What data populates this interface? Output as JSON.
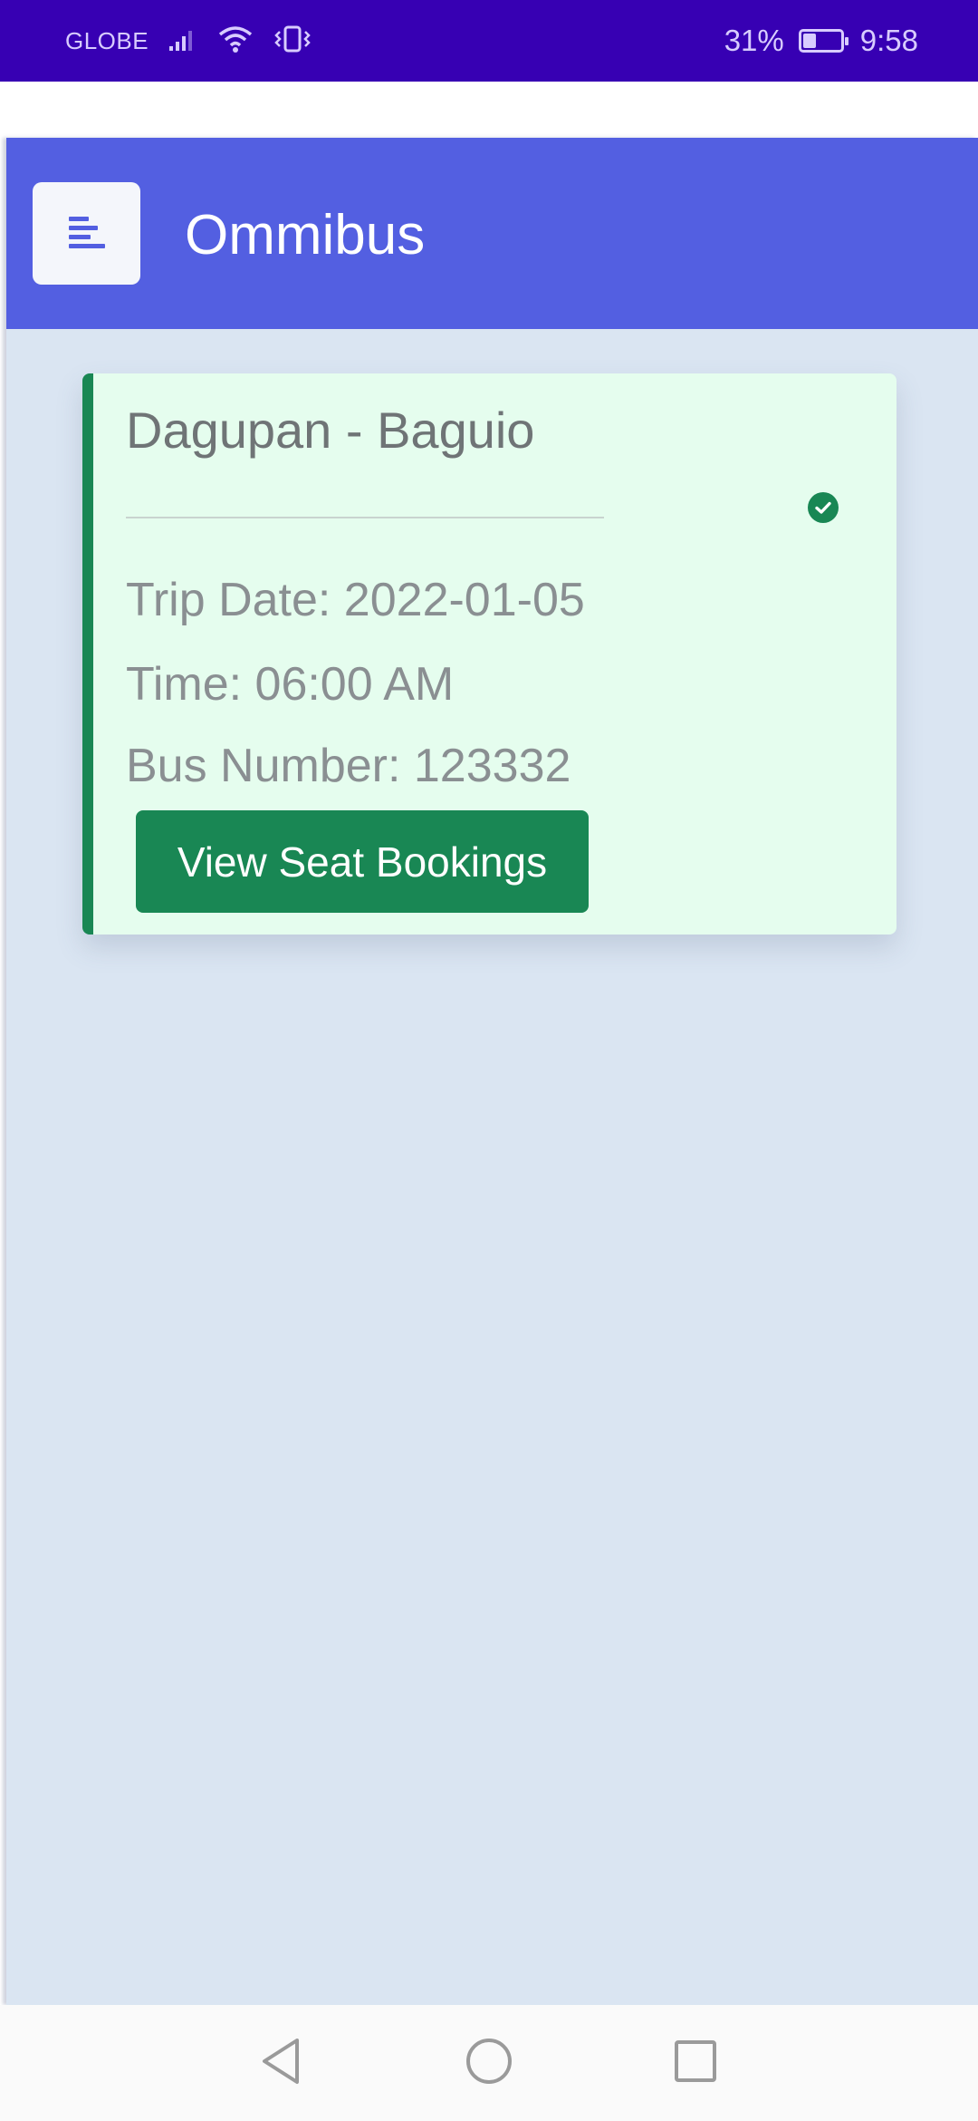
{
  "status_bar": {
    "carrier": "GLOBE",
    "battery": "31%",
    "time": "9:58",
    "icons": [
      "signal-icon",
      "wifi-icon",
      "vibrate-icon",
      "battery-icon"
    ]
  },
  "header": {
    "title": "Ommibus",
    "menu_icon": "menu-icon",
    "color": "#535fe1"
  },
  "trip": {
    "route": "Dagupan - Baguio",
    "trip_date": "Trip Date: 2022-01-05",
    "time": "Time: 06:00 AM",
    "bus_number": "Bus Number: 123332",
    "status_icon": "check-circle-icon",
    "accent_color": "#198754",
    "button_label": "View Seat Bookings"
  },
  "nav_bar": {
    "icons": [
      "back-icon",
      "home-icon",
      "recent-apps-icon"
    ]
  }
}
